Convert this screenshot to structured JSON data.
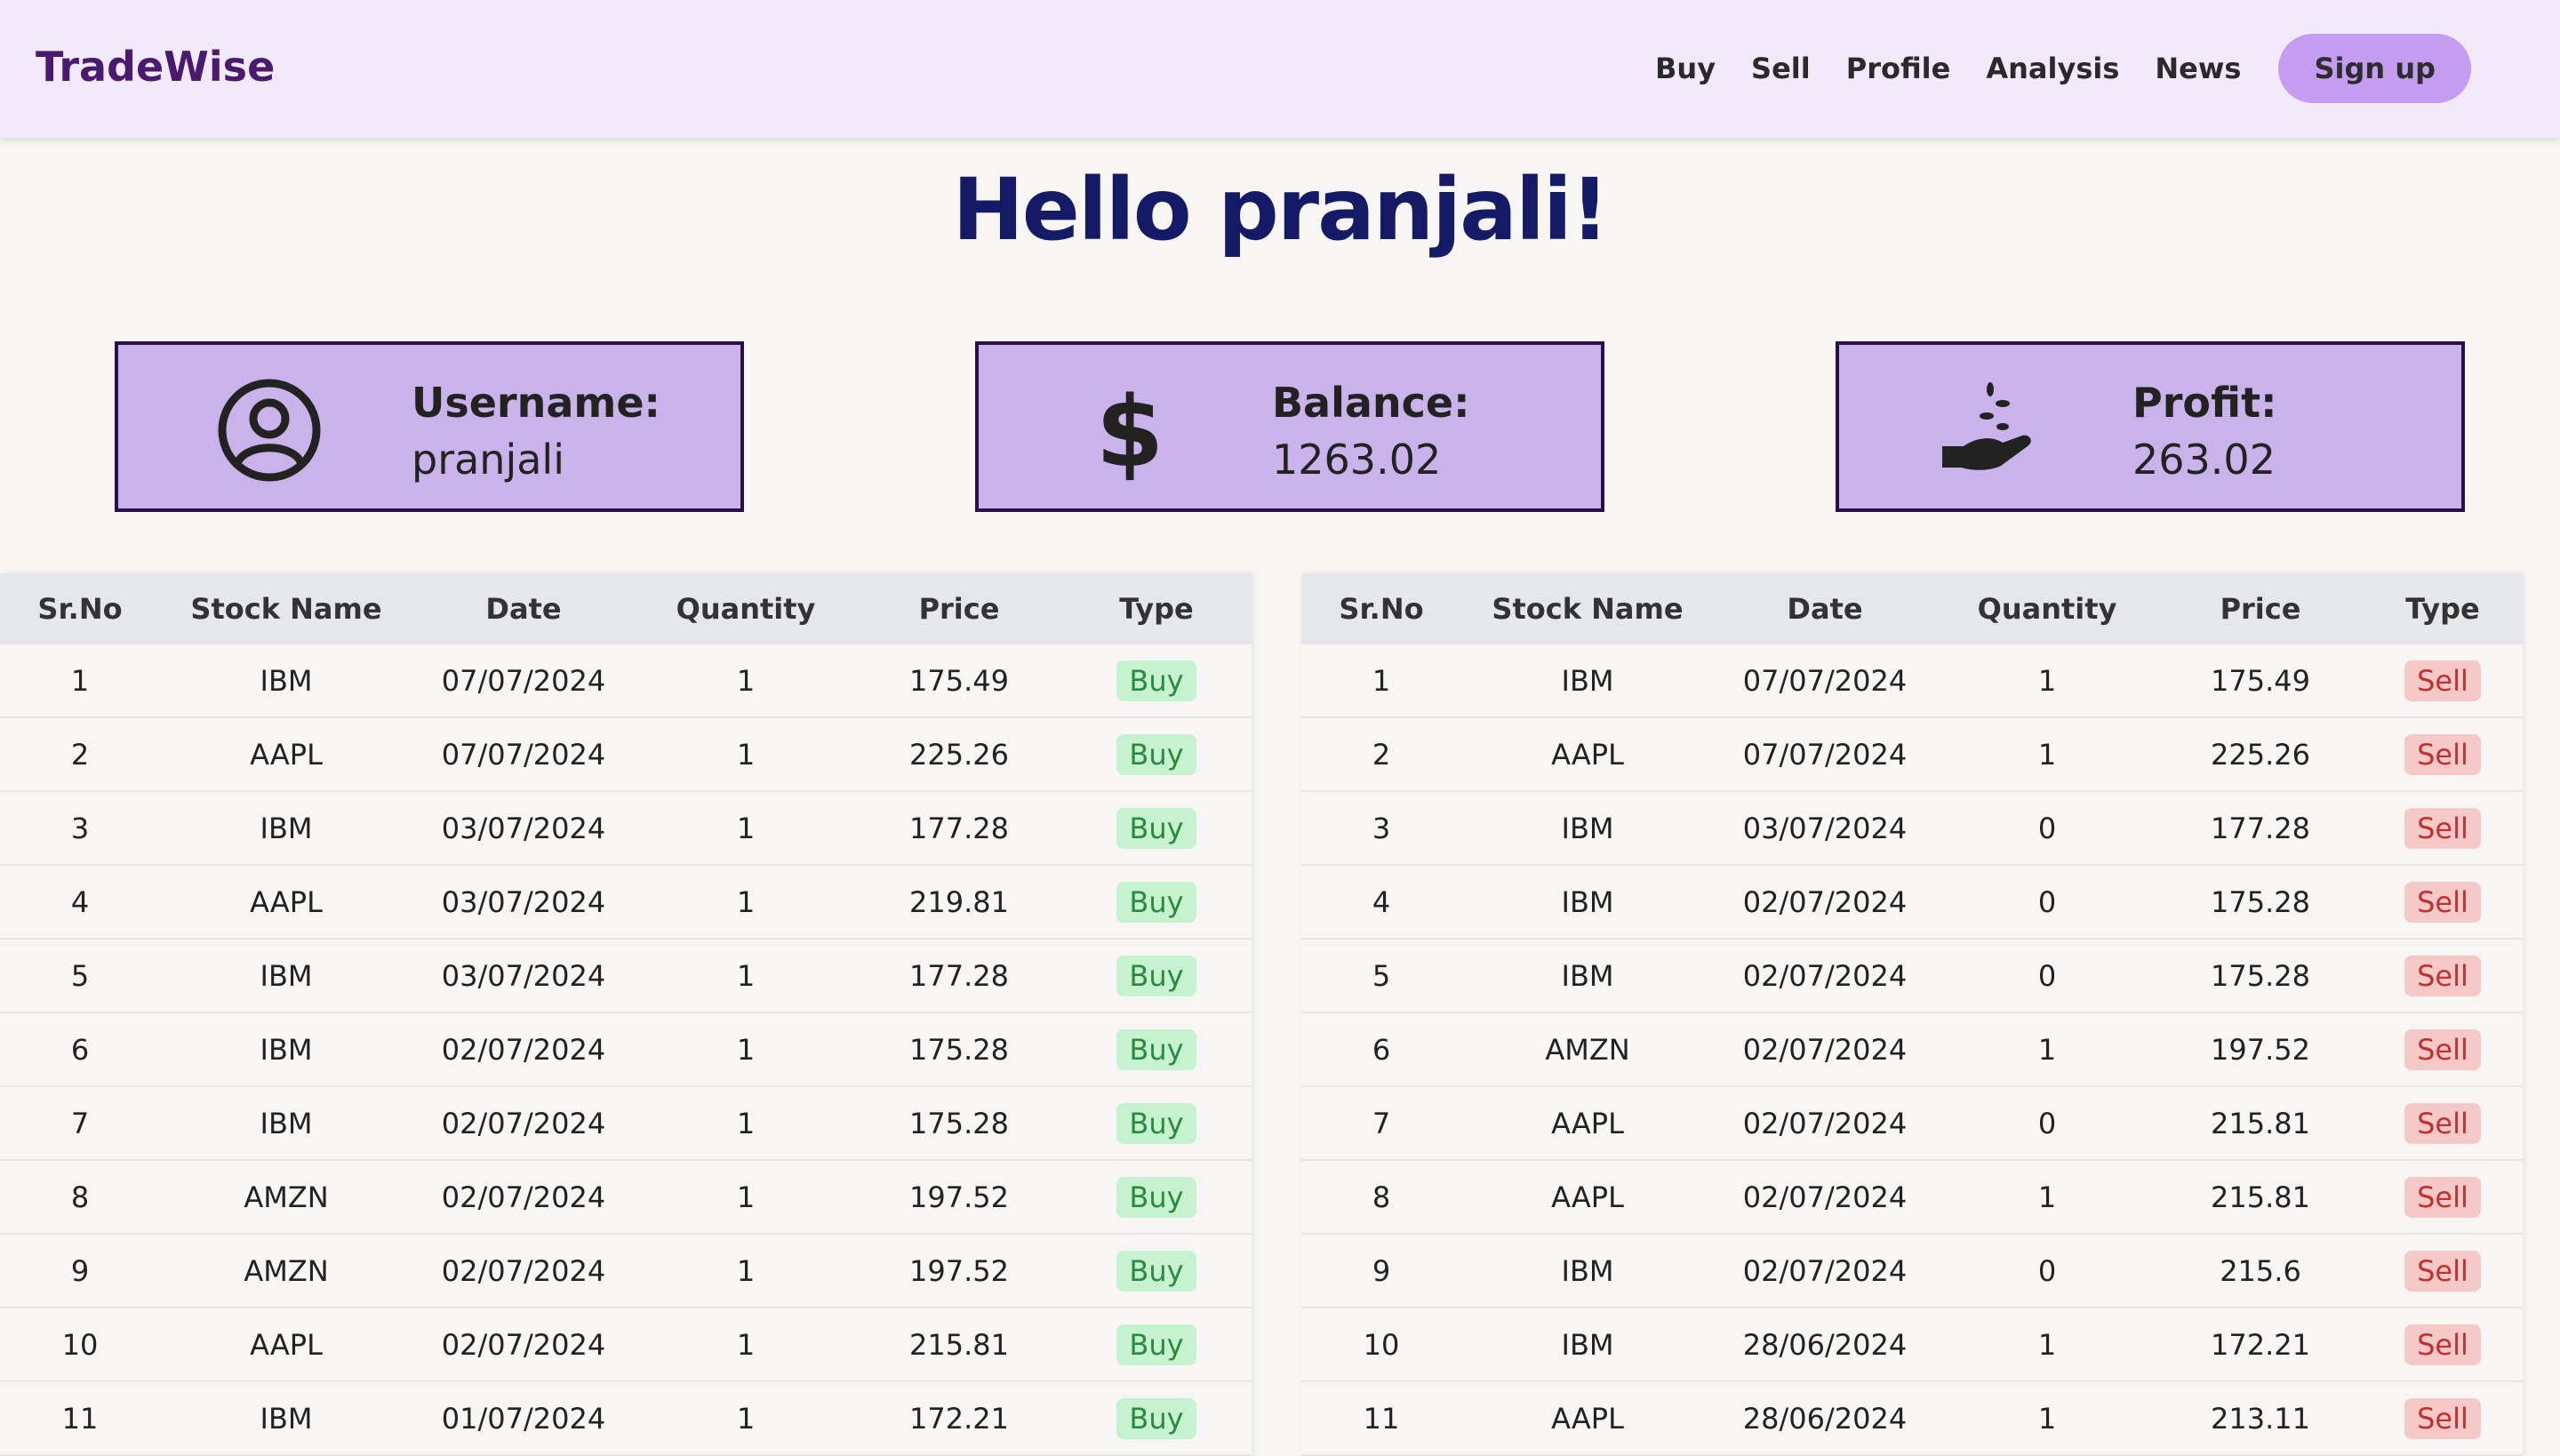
{
  "nav": {
    "brand": "TradeWise",
    "links": [
      "Buy",
      "Sell",
      "Profile",
      "Analysis",
      "News"
    ],
    "signup": "Sign up"
  },
  "greeting": "Hello pranjali!",
  "cards": {
    "username": {
      "label": "Username:",
      "value": "pranjali",
      "icon": "user-circle-icon"
    },
    "balance": {
      "label": "Balance:",
      "value": "1263.02",
      "icon": "dollar-icon"
    },
    "profit": {
      "label": "Profit:",
      "value": "263.02",
      "icon": "hand-seeds-icon"
    }
  },
  "tables": {
    "headers": [
      "Sr.No",
      "Stock Name",
      "Date",
      "Quantity",
      "Price",
      "Type"
    ],
    "buy": {
      "rows": [
        [
          "1",
          "IBM",
          "07/07/2024",
          "1",
          "175.49",
          "Buy"
        ],
        [
          "2",
          "AAPL",
          "07/07/2024",
          "1",
          "225.26",
          "Buy"
        ],
        [
          "3",
          "IBM",
          "03/07/2024",
          "1",
          "177.28",
          "Buy"
        ],
        [
          "4",
          "AAPL",
          "03/07/2024",
          "1",
          "219.81",
          "Buy"
        ],
        [
          "5",
          "IBM",
          "03/07/2024",
          "1",
          "177.28",
          "Buy"
        ],
        [
          "6",
          "IBM",
          "02/07/2024",
          "1",
          "175.28",
          "Buy"
        ],
        [
          "7",
          "IBM",
          "02/07/2024",
          "1",
          "175.28",
          "Buy"
        ],
        [
          "8",
          "AMZN",
          "02/07/2024",
          "1",
          "197.52",
          "Buy"
        ],
        [
          "9",
          "AMZN",
          "02/07/2024",
          "1",
          "197.52",
          "Buy"
        ],
        [
          "10",
          "AAPL",
          "02/07/2024",
          "1",
          "215.81",
          "Buy"
        ],
        [
          "11",
          "IBM",
          "01/07/2024",
          "1",
          "172.21",
          "Buy"
        ]
      ]
    },
    "sell": {
      "rows": [
        [
          "1",
          "IBM",
          "07/07/2024",
          "1",
          "175.49",
          "Sell"
        ],
        [
          "2",
          "AAPL",
          "07/07/2024",
          "1",
          "225.26",
          "Sell"
        ],
        [
          "3",
          "IBM",
          "03/07/2024",
          "0",
          "177.28",
          "Sell"
        ],
        [
          "4",
          "IBM",
          "02/07/2024",
          "0",
          "175.28",
          "Sell"
        ],
        [
          "5",
          "IBM",
          "02/07/2024",
          "0",
          "175.28",
          "Sell"
        ],
        [
          "6",
          "AMZN",
          "02/07/2024",
          "1",
          "197.52",
          "Sell"
        ],
        [
          "7",
          "AAPL",
          "02/07/2024",
          "0",
          "215.81",
          "Sell"
        ],
        [
          "8",
          "AAPL",
          "02/07/2024",
          "1",
          "215.81",
          "Sell"
        ],
        [
          "9",
          "IBM",
          "02/07/2024",
          "0",
          "215.6",
          "Sell"
        ],
        [
          "10",
          "IBM",
          "28/06/2024",
          "1",
          "172.21",
          "Sell"
        ],
        [
          "11",
          "AAPL",
          "28/06/2024",
          "1",
          "213.11",
          "Sell"
        ]
      ]
    }
  },
  "colors": {
    "nav_bg": "#f2eafb",
    "brand": "#4a1a6e",
    "signup_bg": "#c49cf0",
    "greeting": "#141a66",
    "card_bg": "#c9b3ea",
    "buy_badge": "#c6f2cf",
    "sell_badge": "#f6c9c9"
  }
}
